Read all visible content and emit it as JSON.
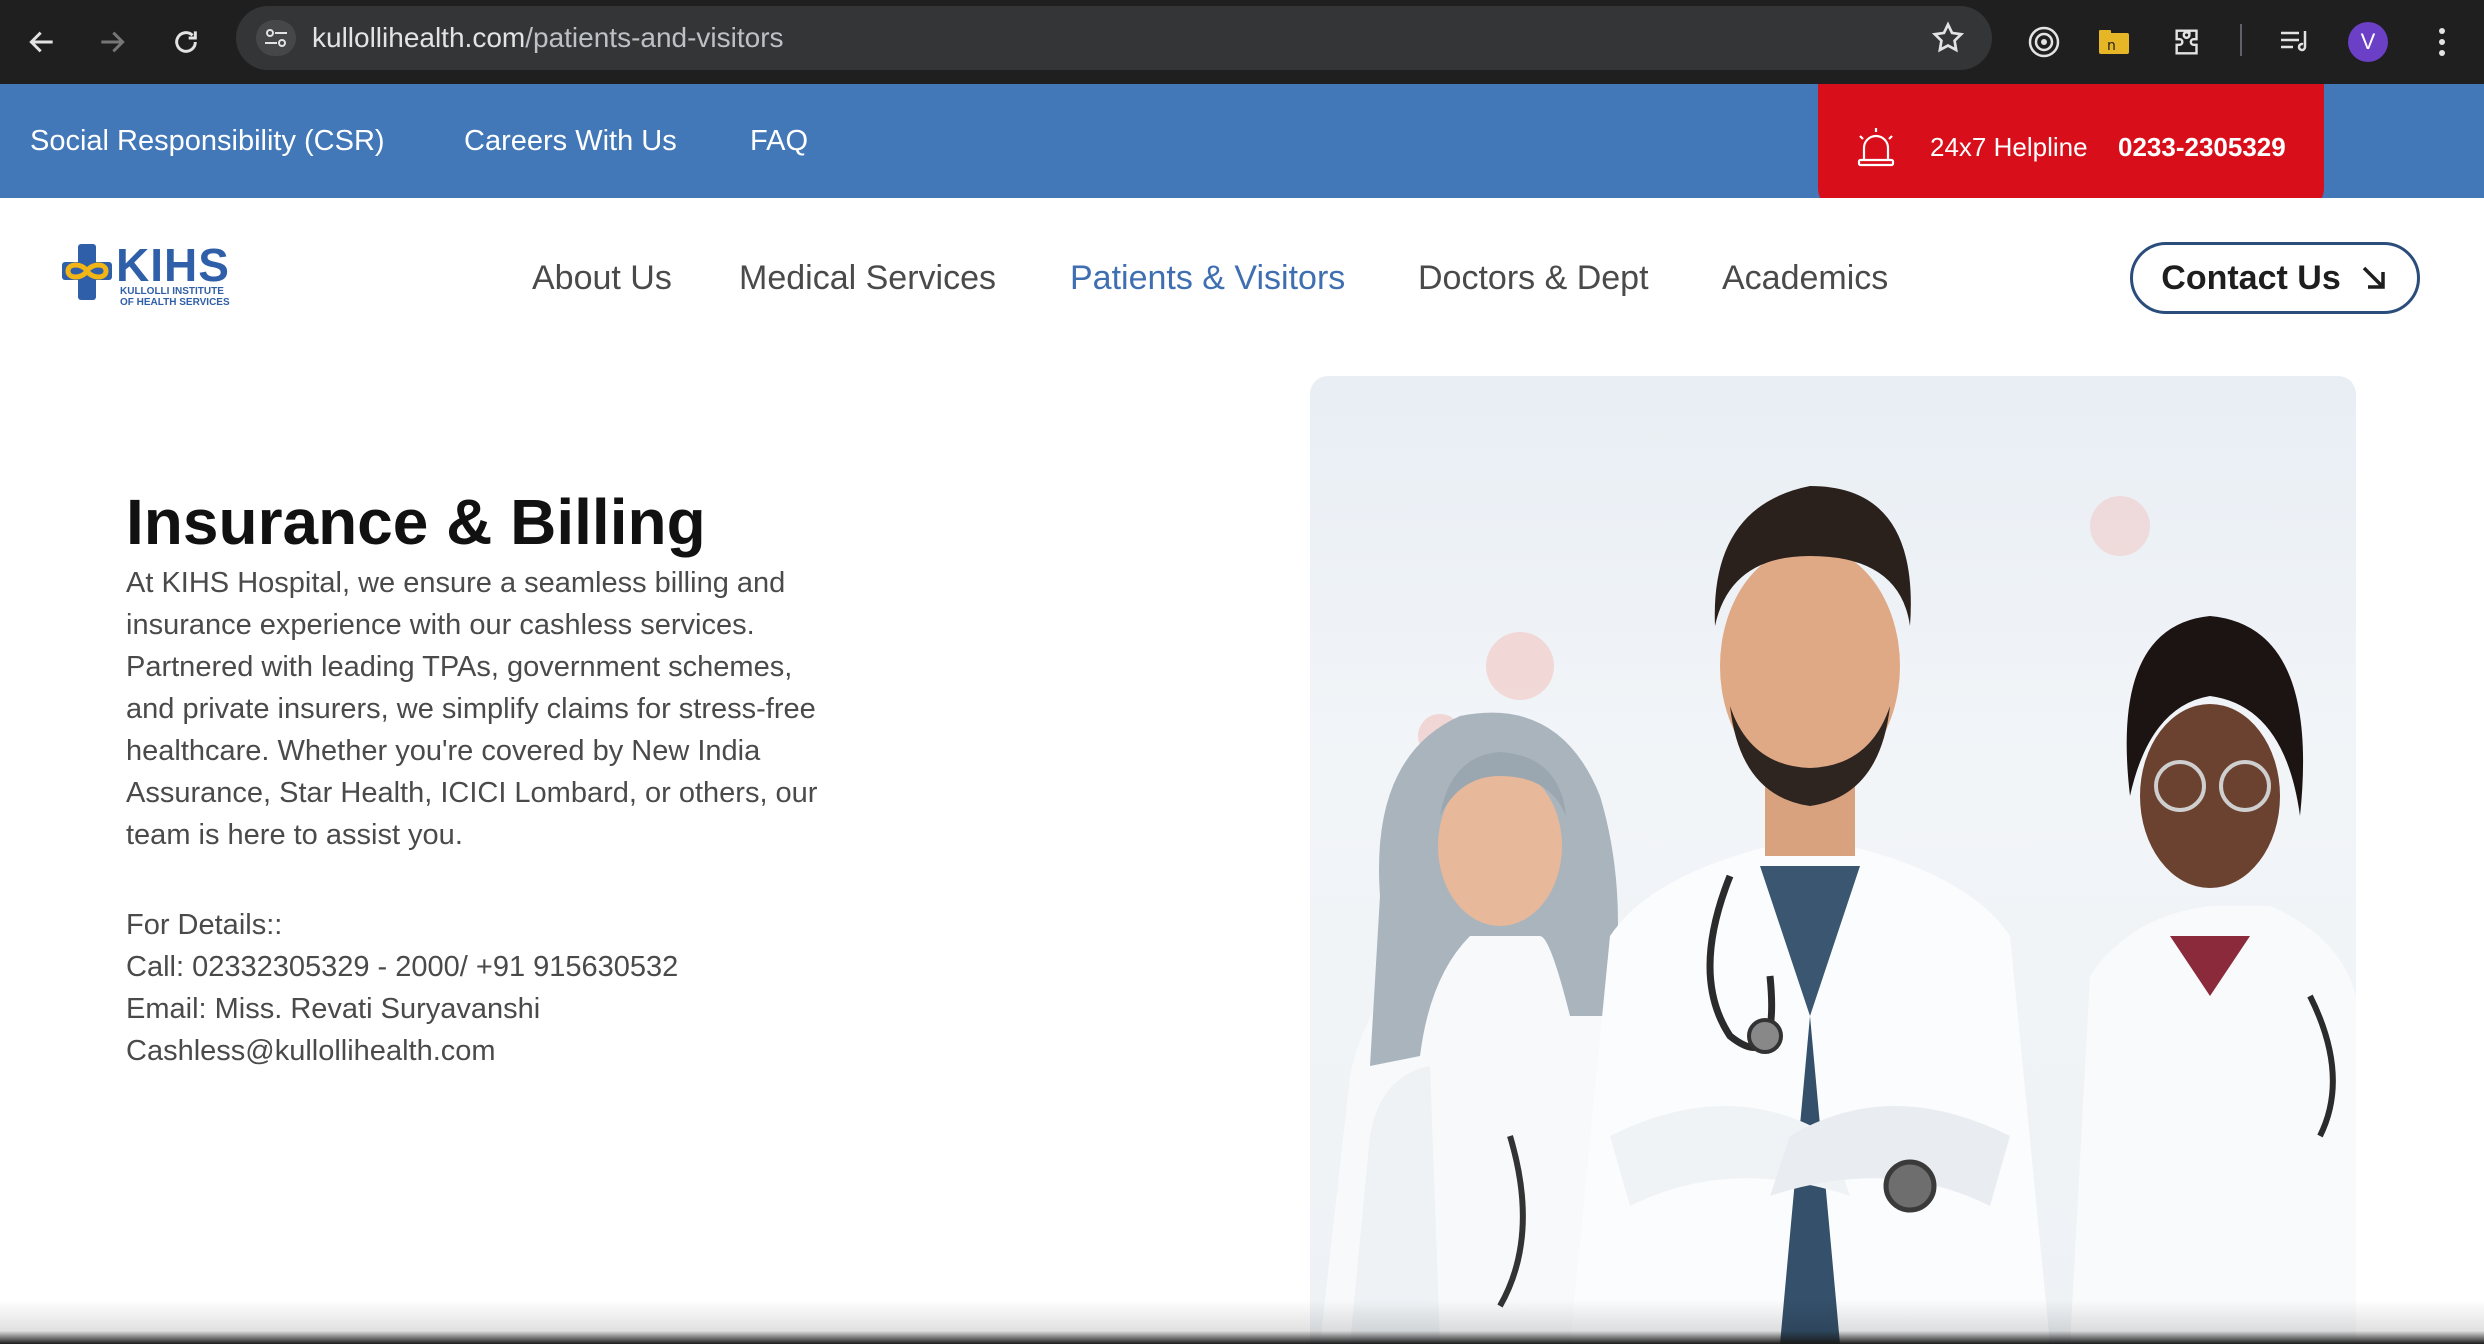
{
  "browser": {
    "url_host": "kullollihealth.com",
    "url_path": "/patients-and-visitors",
    "profile_initial": "V"
  },
  "topbar": {
    "links": [
      "Social Responsibility (CSR)",
      "Careers With Us",
      "FAQ"
    ],
    "helpline_label": "24x7 Helpline",
    "helpline_number": "0233-2305329"
  },
  "logo": {
    "title": "KIHS",
    "subtitle_line1": "KULLOLLI INSTITUTE",
    "subtitle_line2": "OF HEALTH SERVICES"
  },
  "nav": {
    "items": [
      "About Us",
      "Medical Services",
      "Patients & Visitors",
      "Doctors & Dept",
      "Academics"
    ],
    "active": "Patients & Visitors",
    "contact_label": "Contact Us"
  },
  "main": {
    "title": "Insurance & Billing",
    "body_lines": [
      "At KIHS Hospital, we ensure a seamless billing and",
      "insurance experience with our cashless services.",
      "Partnered with leading TPAs, government schemes,",
      "and private insurers, we simplify claims for stress-free",
      "healthcare. Whether you're covered by New India",
      "Assurance, Star Health, ICICI Lombard, or others, our",
      "team is here to assist you."
    ],
    "details_lines": [
      "For Details::",
      "Call: 02332305329 - 2000/ +91 915630532",
      "Email: Miss. Revati Suryavanshi",
      "Cashless@kullollihealth.com"
    ]
  },
  "colors": {
    "topbar": "#4277b8",
    "helpline": "#d80e1b",
    "active_nav": "#3f6fb1"
  }
}
